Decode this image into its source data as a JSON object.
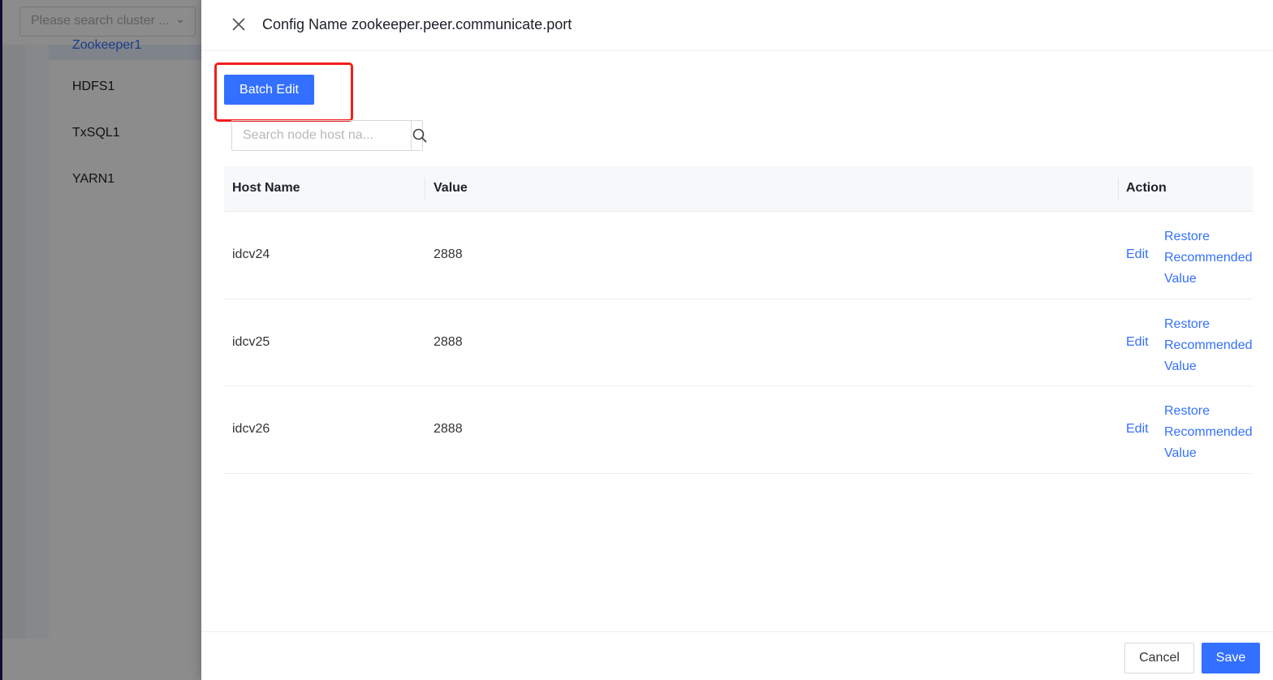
{
  "background": {
    "cluster_search_placeholder": "Please search cluster ...",
    "selected_item": "Zookeeper1",
    "items": [
      "HDFS1",
      "TxSQL1",
      "YARN1"
    ]
  },
  "drawer": {
    "title": "Config Name zookeeper.peer.communicate.port",
    "batch_edit_label": "Batch Edit",
    "search_placeholder": "Search node host na...",
    "table": {
      "columns": [
        "Host Name",
        "Value",
        "Action"
      ],
      "rows": [
        {
          "host": "idcv24",
          "value": "2888",
          "edit": "Edit",
          "restore": "Restore Recommended Value"
        },
        {
          "host": "idcv25",
          "value": "2888",
          "edit": "Edit",
          "restore": "Restore Recommended Value"
        },
        {
          "host": "idcv26",
          "value": "2888",
          "edit": "Edit",
          "restore": "Restore Recommended Value"
        }
      ]
    },
    "footer": {
      "cancel_label": "Cancel",
      "save_label": "Save"
    }
  },
  "colors": {
    "primary": "#3370ff",
    "highlight": "#f51d1d"
  }
}
